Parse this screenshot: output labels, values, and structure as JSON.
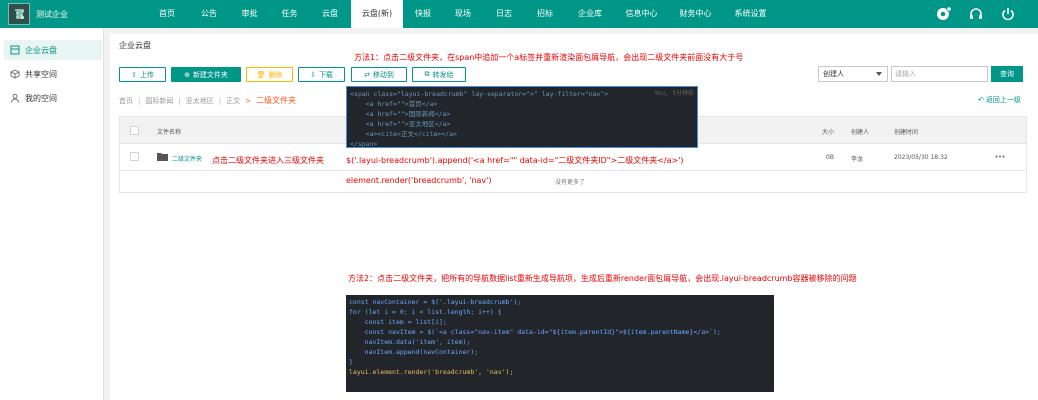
{
  "brand": {
    "title": "测试企业"
  },
  "nav": {
    "items": [
      {
        "label": "首页",
        "active": false
      },
      {
        "label": "公告",
        "active": false
      },
      {
        "label": "审批",
        "active": false
      },
      {
        "label": "任务",
        "active": false
      },
      {
        "label": "云盘",
        "active": false
      },
      {
        "label": "云盘(新)",
        "active": true
      },
      {
        "label": "快报",
        "active": false
      },
      {
        "label": "现场",
        "active": false
      },
      {
        "label": "日志",
        "active": false
      },
      {
        "label": "招标",
        "active": false
      },
      {
        "label": "企业库",
        "active": false
      },
      {
        "label": "信息中心",
        "active": false
      },
      {
        "label": "财务中心",
        "active": false
      },
      {
        "label": "系统设置",
        "active": false
      }
    ],
    "icons": [
      "gear-badge-icon",
      "headset-icon",
      "power-icon"
    ]
  },
  "sidebar": {
    "items": [
      {
        "label": "企业云盘",
        "icon": "cloud-drive-icon",
        "active": true
      },
      {
        "label": "共享空间",
        "icon": "share-cube-icon",
        "active": false
      },
      {
        "label": "我的空间",
        "icon": "user-icon",
        "active": false
      }
    ]
  },
  "main": {
    "title": "企业云盘",
    "toolbar": {
      "upload": "上传",
      "new_folder": "新建文件夹",
      "delete": "删除",
      "download": "下载",
      "move": "移动到",
      "transfer": "转发给"
    },
    "filter": {
      "selected": "创建人",
      "placeholder": "请输入",
      "query": "查询"
    },
    "breadcrumb": {
      "items": [
        "首页",
        "国际新闻",
        "亚太地区",
        "正文"
      ],
      "current": "二级文件夹"
    },
    "back": "返回上一级",
    "table": {
      "headers": {
        "name": "文件名称",
        "size": "大小",
        "creator": "创建人",
        "created": "创建时间"
      },
      "rows": [
        {
          "name": "二级文件夹",
          "size": "0B",
          "creator": "李龙",
          "created": "2023/05/30 18:32"
        }
      ],
      "empty": "没有更多了"
    }
  },
  "annotations": {
    "method1": "方法1：点击二级文件夹，在span中追加一个a标签并重新渲染面包屑导航，会出现二级文件夹前面没有大于号",
    "click_hint": "点击二级文件夹进入三级文件夹",
    "append_code": "$('.layui-breadcrumb').append('<a href=\"\" data-id=\"二级文件夹ID\">二级文件夹</a>')",
    "render_code": "element.render('breadcrumb', 'nav')",
    "method2": "方法2：点击二级文件夹，把所有的导航数据list重新生成导航项，生成后重新render面包屑导航，会出现.layui-breadcrumb容器被移除的问题",
    "code_hint": "You, 5分钟前",
    "code1": [
      "<span class=\"layui-breadcrumb\" lay-separator=\">\" lay-filter=\"nav\">",
      "    <a href=\"\">首页</a>",
      "    <a href=\"\">国际新闻</a>",
      "    <a href=\"\">亚太地区</a>",
      "    <a><cite>正文</cite></a>",
      "</span>"
    ],
    "code2": [
      "const navContainer = $('.layui-breadcrumb');",
      "for (let i = 0; i < list.length; i++) {",
      "    const item = list[i];",
      "    const navItem = $(`<a class=\"nav-item\" data-id=\"${item.parentId}\">${item.parentName}</a>`);",
      "    navItem.data('item', item);",
      "    navItem.append(navContainer);",
      "}",
      "",
      "layui.element.render('breadcrumb', 'nav');"
    ]
  }
}
